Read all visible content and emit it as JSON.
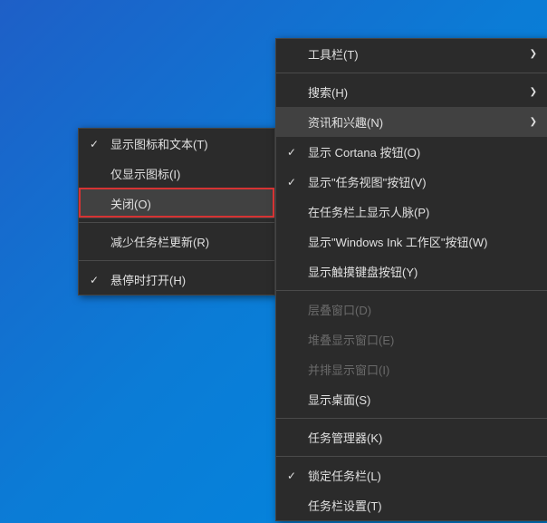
{
  "submenu": {
    "items": [
      {
        "label": "显示图标和文本(T)",
        "checked": true
      },
      {
        "label": "仅显示图标(I)",
        "checked": false
      },
      {
        "label": "关闭(O)",
        "checked": false,
        "highlighted": true
      },
      {
        "label": "减少任务栏更新(R)",
        "checked": false
      },
      {
        "label": "悬停时打开(H)",
        "checked": true
      }
    ]
  },
  "mainmenu": {
    "groups": [
      {
        "items": [
          {
            "label": "工具栏(T)",
            "arrow": true
          },
          {
            "label": "搜索(H)",
            "arrow": true
          },
          {
            "label": "资讯和兴趣(N)",
            "arrow": true,
            "highlighted": true
          },
          {
            "label": "显示 Cortana 按钮(O)",
            "checked": true
          },
          {
            "label": "显示\"任务视图\"按钮(V)",
            "checked": true
          },
          {
            "label": "在任务栏上显示人脉(P)"
          },
          {
            "label": "显示\"Windows Ink 工作区\"按钮(W)"
          },
          {
            "label": "显示触摸键盘按钮(Y)"
          }
        ]
      },
      {
        "items": [
          {
            "label": "层叠窗口(D)",
            "disabled": true
          },
          {
            "label": "堆叠显示窗口(E)",
            "disabled": true
          },
          {
            "label": "并排显示窗口(I)",
            "disabled": true
          },
          {
            "label": "显示桌面(S)"
          }
        ]
      },
      {
        "items": [
          {
            "label": "任务管理器(K)"
          }
        ]
      },
      {
        "items": [
          {
            "label": "锁定任务栏(L)",
            "checked": true
          },
          {
            "label": "任务栏设置(T)"
          }
        ]
      }
    ]
  }
}
